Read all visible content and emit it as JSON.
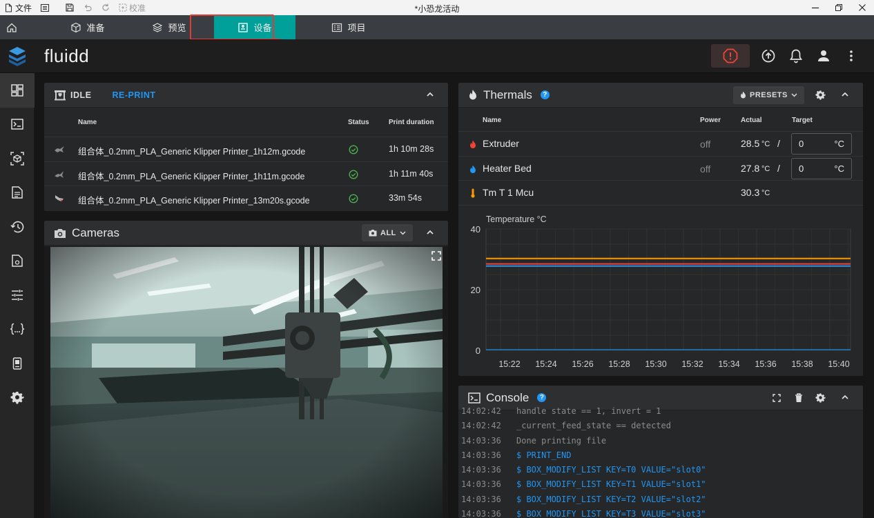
{
  "titlebar": {
    "file": "文件",
    "calibrate": "校准",
    "title": "*小恐龙活动"
  },
  "tabs": [
    {
      "label": "准备"
    },
    {
      "label": "预览"
    },
    {
      "label": "设备"
    },
    {
      "label": "项目"
    }
  ],
  "app": {
    "brand": "fluidd"
  },
  "jobs": {
    "state": "IDLE",
    "reprint": "RE-PRINT",
    "columns": {
      "name": "Name",
      "status": "Status",
      "duration": "Print duration"
    },
    "rows": [
      {
        "name": "组合体_0.2mm_PLA_Generic Klipper Printer_1h12m.gcode",
        "duration": "1h 10m 28s"
      },
      {
        "name": "组合体_0.2mm_PLA_Generic Klipper Printer_1h11m.gcode",
        "duration": "1h 11m 40s"
      },
      {
        "name": "组合体_0.2mm_PLA_Generic Klipper Printer_13m20s.gcode",
        "duration": "33m 54s"
      }
    ]
  },
  "cameras": {
    "title": "Cameras",
    "filter": "ALL"
  },
  "thermals": {
    "title": "Thermals",
    "presets": "PRESETS",
    "columns": {
      "name": "Name",
      "power": "Power",
      "actual": "Actual",
      "target": "Target"
    },
    "rows": [
      {
        "name": "Extruder",
        "power": "off",
        "actual": "28.5",
        "unit": "°C",
        "sep": "/",
        "target": "0",
        "target_unit": "°C",
        "color": "#f44336"
      },
      {
        "name": "Heater Bed",
        "power": "off",
        "actual": "27.8",
        "unit": "°C",
        "sep": "/",
        "target": "0",
        "target_unit": "°C",
        "color": "#2196f3"
      },
      {
        "name": "Tm T 1 Mcu",
        "actual": "30.3",
        "unit": "°C",
        "color": "#ff9800"
      }
    ]
  },
  "chart_data": {
    "type": "line",
    "title": "Temperature °C",
    "xlabel": "",
    "ylabel": "Temperature °C",
    "ylim": [
      0,
      40
    ],
    "yticks": [
      0,
      20,
      40
    ],
    "x": [
      "15:22",
      "15:24",
      "15:26",
      "15:28",
      "15:30",
      "15:32",
      "15:34",
      "15:36",
      "15:38",
      "15:40"
    ],
    "grid": true,
    "series": [
      {
        "name": "Tm T 1 Mcu",
        "color": "#ff9800",
        "values": [
          30.3,
          30.3,
          30.3,
          30.3,
          30.3,
          30.3,
          30.3,
          30.3,
          30.3,
          30.3
        ]
      },
      {
        "name": "Extruder",
        "color": "#f44336",
        "values": [
          28.5,
          28.5,
          28.5,
          28.5,
          28.5,
          28.5,
          28.5,
          28.5,
          28.5,
          28.5
        ]
      },
      {
        "name": "Heater Bed",
        "color": "#2196f3",
        "values": [
          27.8,
          27.8,
          27.8,
          27.8,
          27.8,
          27.8,
          27.8,
          27.8,
          27.8,
          27.8
        ]
      }
    ]
  },
  "console": {
    "title": "Console",
    "lines": [
      {
        "ts": "14:02:42",
        "msg": "handle state == 1, invert = 1",
        "cmd": false
      },
      {
        "ts": "14:02:42",
        "msg": "_current_feed_state == detected",
        "cmd": false
      },
      {
        "ts": "14:03:36",
        "msg": "Done printing file",
        "cmd": false
      },
      {
        "ts": "14:03:36",
        "msg": "$ PRINT_END",
        "cmd": true
      },
      {
        "ts": "14:03:36",
        "msg": "$ BOX_MODIFY_LIST KEY=T0 VALUE=\"slot0\"",
        "cmd": true
      },
      {
        "ts": "14:03:36",
        "msg": "$ BOX_MODIFY_LIST KEY=T1 VALUE=\"slot1\"",
        "cmd": true
      },
      {
        "ts": "14:03:36",
        "msg": "$ BOX_MODIFY_LIST KEY=T2 VALUE=\"slot2\"",
        "cmd": true
      },
      {
        "ts": "14:03:36",
        "msg": "$ BOX_MODIFY_LIST KEY=T3 VALUE=\"slot3\"",
        "cmd": true
      }
    ]
  },
  "colors": {
    "accent": "#00a09a",
    "highlight": "#e53935",
    "link": "#2196f3",
    "success": "#4caf50"
  }
}
